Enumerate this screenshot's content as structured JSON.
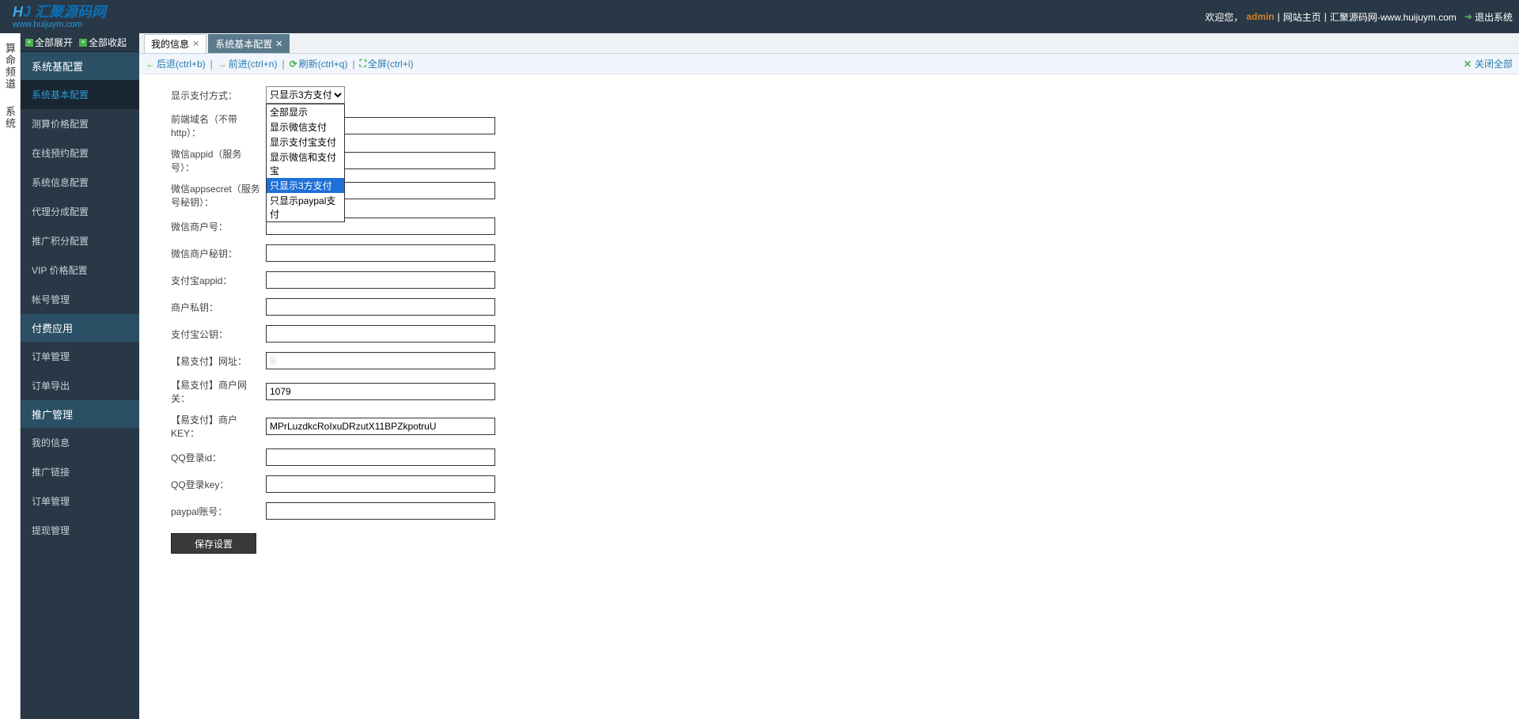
{
  "header": {
    "logo_cn": "汇聚源码网",
    "logo_domain": "www.huijuym.com",
    "welcome": "欢迎您，",
    "username": "admin",
    "link_home": "网站主页",
    "link_brand": "汇聚源码网-",
    "brand_domain": "www.huijuym.com",
    "logout": "退出系统"
  },
  "rail": {
    "group1": "算命频道",
    "group2": "系统"
  },
  "expand": {
    "expand_all": "全部展开",
    "collapse_all": "全部收起"
  },
  "sidebar": {
    "groups": [
      {
        "title": "系统基配置",
        "items": [
          "系统基本配置",
          "测算价格配置",
          "在线预约配置",
          "系统信息配置",
          "代理分成配置",
          "推广积分配置",
          "VIP 价格配置",
          "帐号管理"
        ]
      },
      {
        "title": "付费应用",
        "items": [
          "订单管理",
          "订单导出"
        ]
      },
      {
        "title": "推广管理",
        "items": [
          "我的信息",
          "推广链接",
          "订单管理",
          "提现管理"
        ]
      }
    ]
  },
  "tabs": [
    {
      "label": "我的信息",
      "active": false
    },
    {
      "label": "系统基本配置",
      "active": true
    }
  ],
  "toolbar": {
    "back": "后退(ctrl+b)",
    "forward": "前进(ctrl+n)",
    "refresh": "刷新(ctrl+q)",
    "fullscreen": "全屏(ctrl+i)",
    "close_all": "关闭全部"
  },
  "form": {
    "fields": {
      "pay_mode_label": "显示支付方式：",
      "domain_label": "前端域名（不带http）：",
      "wx_appid_label": "微信appid（服务号）：",
      "wx_secret_label": "微信appsecret（服务号秘钥）：",
      "wx_mch_label": "微信商户号：",
      "wx_mch_key_label": "微信商户秘钥：",
      "ali_appid_label": "支付宝appid：",
      "mch_priv_label": "商户私钥：",
      "ali_pub_label": "支付宝公钥：",
      "epay_url_label": "【易支付】网址：",
      "epay_gw_label": "【易支付】商户网关：",
      "epay_key_label": "【易支付】商户KEY：",
      "qq_id_label": "QQ登录id：",
      "qq_key_label": "QQ登录key：",
      "paypal_label": "paypal账号："
    },
    "values": {
      "pay_mode_selected": "只显示3方支付",
      "epay_url": "h",
      "epay_gw": "1079",
      "epay_key": "MPrLuzdkcRoIxuDRzutX11BPZkpotruU"
    },
    "pay_options": [
      "全部显示",
      "显示微信支付",
      "显示支付宝支付",
      "显示微信和支付宝",
      "只显示3方支付",
      "只显示paypal支付"
    ],
    "save_btn": "保存设置"
  }
}
